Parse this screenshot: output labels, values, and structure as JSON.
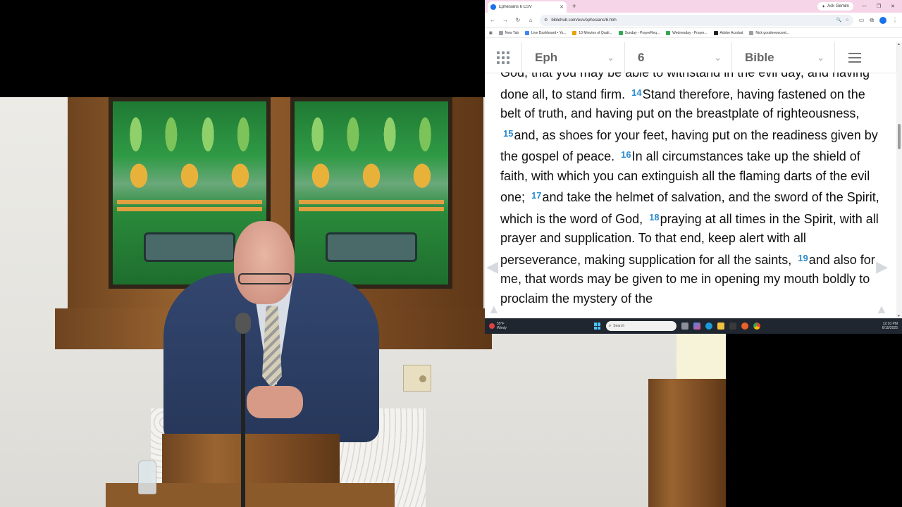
{
  "browser": {
    "tab_title": "Ephesians 6 ESV",
    "new_tab_glyph": "+",
    "ask_button": "Ask Gemini",
    "url": "biblehub.com/esv/ephesians/6.htm",
    "bookmarks": [
      "New Tab",
      "Live Dashboard • Yo...",
      "10 Minutes of Quali...",
      "Sunday - PrayerReq...",
      "Wednesday - Prayer...",
      "Adobe Acrobat",
      "Nick goodnewscent..."
    ],
    "bookmark_colors": [
      "#9aa0a6",
      "#4285f4",
      "#e8a200",
      "#34a853",
      "#34a853",
      "#202124",
      "#9aa0a6"
    ]
  },
  "biblehub": {
    "book": "Eph",
    "chapter": "6",
    "version": "Bible",
    "verse_color": "#2a8bd0",
    "passage": [
      {
        "text": "God, that you may be able to withstand in the evil day, and having done all, to stand firm."
      },
      {
        "num": "14",
        "text": "Stand therefore, having fastened on the belt of truth, and having put on the breastplate of righteousness,"
      },
      {
        "num": "15",
        "text": "and, as shoes for your feet, having put on the readiness given by the gospel of peace."
      },
      {
        "num": "16",
        "text": "In all circumstances take up the shield of faith, with which you can extinguish all the flaming darts of the evil one;"
      },
      {
        "num": "17",
        "text": "and take the helmet of salvation, and the sword of the Spirit, which is the word of God,"
      },
      {
        "num": "18",
        "text": "praying at all times in the Spirit, with all prayer and supplication. To that end, keep alert with all perseverance, making supplication for all the saints,"
      },
      {
        "num": "19",
        "text": "and also for me, that words may be given to me in opening my mouth boldly to proclaim the mystery of the"
      }
    ]
  },
  "taskbar": {
    "weather_temp": "55°F",
    "weather_desc": "Windy",
    "search_placeholder": "Search",
    "time": "12:10 PM",
    "date": "6/15/2025"
  }
}
